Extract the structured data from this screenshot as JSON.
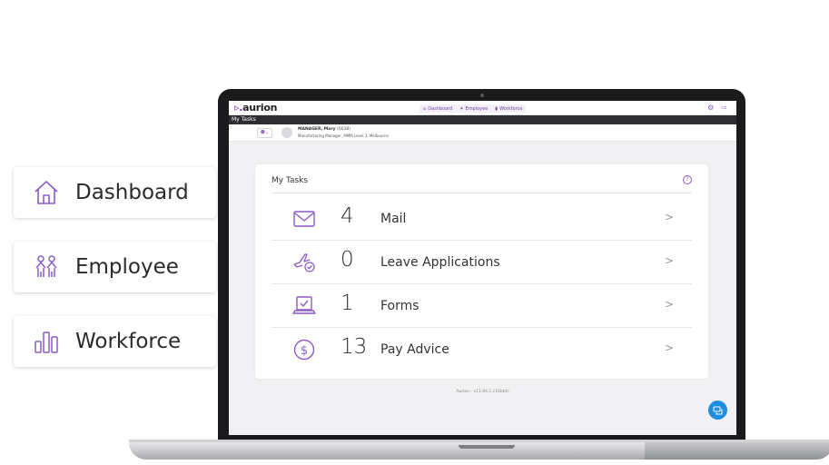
{
  "side_nav": {
    "items": [
      {
        "label": "Dashboard",
        "icon": "home-icon"
      },
      {
        "label": "Employee",
        "icon": "people-icon"
      },
      {
        "label": "Workforce",
        "icon": "bar-chart-icon"
      }
    ]
  },
  "app": {
    "logo": "aurion",
    "nav": [
      {
        "label": "Dashboard",
        "icon": "home-icon"
      },
      {
        "label": "Employee",
        "icon": "people-icon"
      },
      {
        "label": "Workforce",
        "icon": "bar-chart-icon"
      }
    ],
    "page_title": "My Tasks",
    "user": {
      "name": "MANAGER, Mary",
      "id": "(6038)",
      "role": "Manufacturing Manager, MMM Level 3, Melbourne"
    },
    "panel_title": "My Tasks",
    "tasks": [
      {
        "count": "4",
        "label": "Mail",
        "icon": "mail-icon"
      },
      {
        "count": "0",
        "label": "Leave Applications",
        "icon": "plane-check-icon"
      },
      {
        "count": "1",
        "label": "Forms",
        "icon": "laptop-check-icon"
      },
      {
        "count": "13",
        "label": "Pay Advice",
        "icon": "dollar-icon"
      }
    ],
    "footer": "Aurion - v11.94.1.c16bbfc",
    "chevron": ">"
  },
  "colors": {
    "accent": "#8b5cc7",
    "chat": "#1e8ee0",
    "dark_bar": "#2d2d31"
  }
}
